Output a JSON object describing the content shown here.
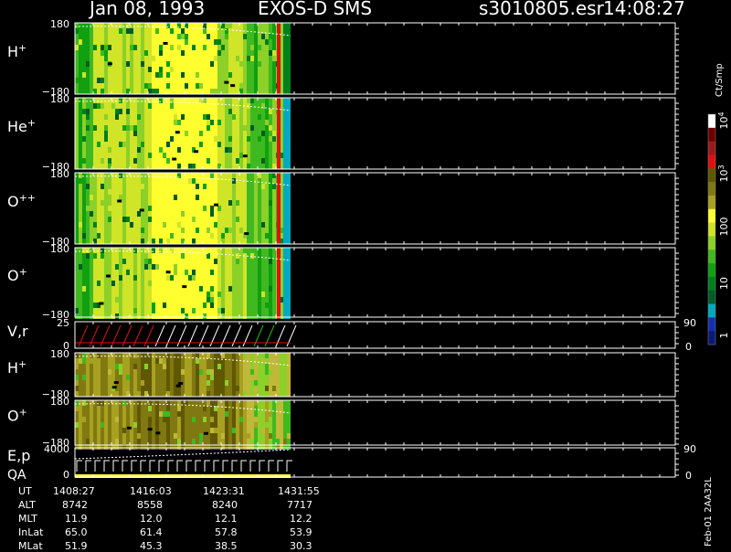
{
  "header": {
    "date": "Jan 08, 1993",
    "instrument": "EXOS-D SMS",
    "file": "s3010805.esr",
    "time": "14:08:27"
  },
  "colorbar": {
    "unit_label": "Ct/Smp",
    "scale": "log",
    "range": [
      1,
      10000
    ],
    "tick_labels": [
      "1",
      "10",
      "100",
      "10",
      "10"
    ],
    "tick_superscripts": [
      "",
      "",
      "",
      "3",
      "4"
    ],
    "colors": [
      "#0a1a78",
      "#1230b0",
      "#00a8c0",
      "#005c28",
      "#00801c",
      "#10a010",
      "#40b820",
      "#8cd028",
      "#d0e428",
      "#ffff30",
      "#a8a020",
      "#807810",
      "#605800",
      "#e01010",
      "#a01818",
      "#700000",
      "#ffffff"
    ]
  },
  "footer": {
    "row_labels": [
      "UT",
      "ALT",
      "MLT",
      "InLat",
      "MLat"
    ],
    "columns": [
      [
        "1408:27",
        "8742",
        "11.9",
        "65.0",
        "51.9"
      ],
      [
        "1416:03",
        "8558",
        "12.0",
        "61.4",
        "45.3"
      ],
      [
        "1423:31",
        "8240",
        "12.1",
        "57.8",
        "38.5"
      ],
      [
        "1431:55",
        "7717",
        "12.2",
        "53.9",
        "30.3"
      ]
    ],
    "side_note": "Feb-01 2AA32L"
  },
  "chart_data": {
    "type": "heatmap",
    "title": "Jan 08, 1993   EXOS-D SMS",
    "x_ut_ticks": [
      "1408:27",
      "1416:03",
      "1423:31",
      "1431:55"
    ],
    "panels": [
      {
        "label": "H",
        "sup": "+",
        "ytop": "180",
        "ybottom": "−180",
        "kind": "spectrogram",
        "scheme": "bright"
      },
      {
        "label": "He",
        "sup": "+",
        "ytop": "180",
        "ybottom": "−180",
        "kind": "spectrogram",
        "scheme": "bright"
      },
      {
        "label": "O",
        "sup": "++",
        "ytop": "180",
        "ybottom": "−180",
        "kind": "spectrogram",
        "scheme": "bright"
      },
      {
        "label": "O",
        "sup": "+",
        "ytop": "180",
        "ybottom": "−180",
        "kind": "spectrogram",
        "scheme": "bright"
      },
      {
        "label": "V,r",
        "sup": "",
        "ytop": "25",
        "ybottom": "0",
        "right_top": "90",
        "right_bottom": "0",
        "kind": "trace"
      },
      {
        "label": "H",
        "sup": "+",
        "ytop": "180",
        "ybottom": "−180",
        "kind": "spectrogram",
        "scheme": "olive"
      },
      {
        "label": "O",
        "sup": "+",
        "ytop": "180",
        "ybottom": "−180",
        "kind": "spectrogram",
        "scheme": "olive"
      },
      {
        "label": "E,p",
        "label2": "QA",
        "sup": "",
        "ytop": "4000",
        "ybottom": "0",
        "right_top": "90",
        "right_bottom": "0",
        "kind": "energy"
      }
    ]
  }
}
